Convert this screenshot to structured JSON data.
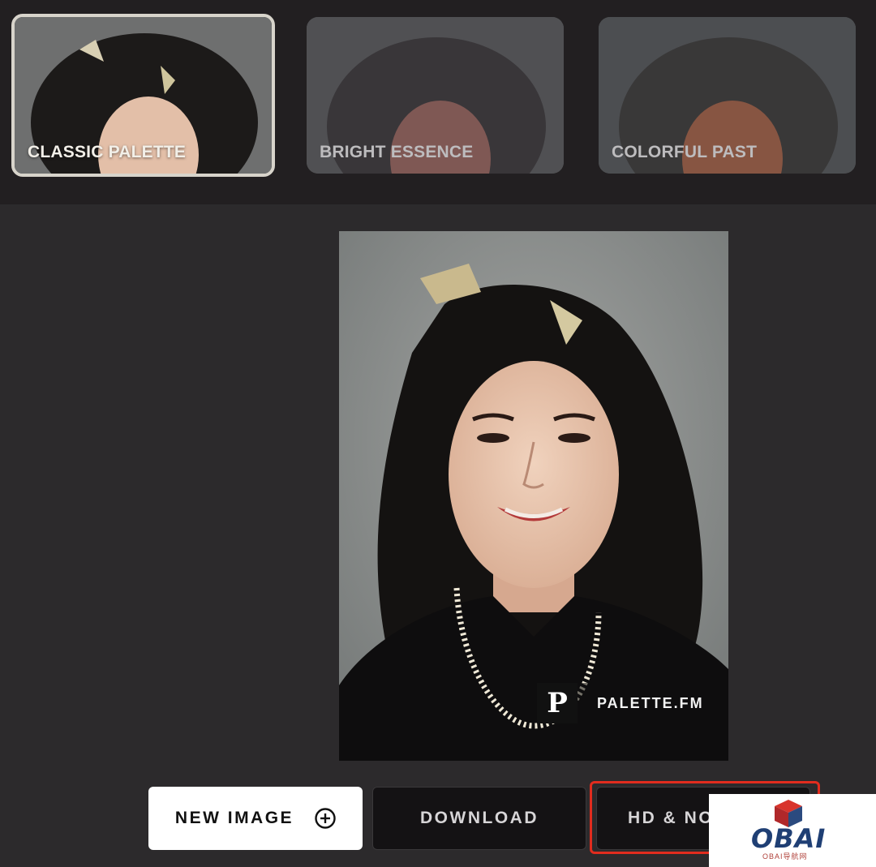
{
  "filters": [
    {
      "label": "CLASSIC PALETTE",
      "selected": true
    },
    {
      "label": "BRIGHT ESSENCE",
      "selected": false
    },
    {
      "label": "COLORFUL PAST",
      "selected": false
    }
  ],
  "preview": {
    "watermark_logo": "P",
    "watermark_text": "PALETTE.FM"
  },
  "actions": {
    "new_image_label": "NEW IMAGE",
    "new_image_icon": "plus-circle-icon",
    "download_label": "DOWNLOAD",
    "hd_label": "HD & NO"
  },
  "overlay": {
    "site_logo_text": "OBAI",
    "site_logo_sub": "OBAI导航网",
    "highlight_color": "#e12c1e"
  }
}
